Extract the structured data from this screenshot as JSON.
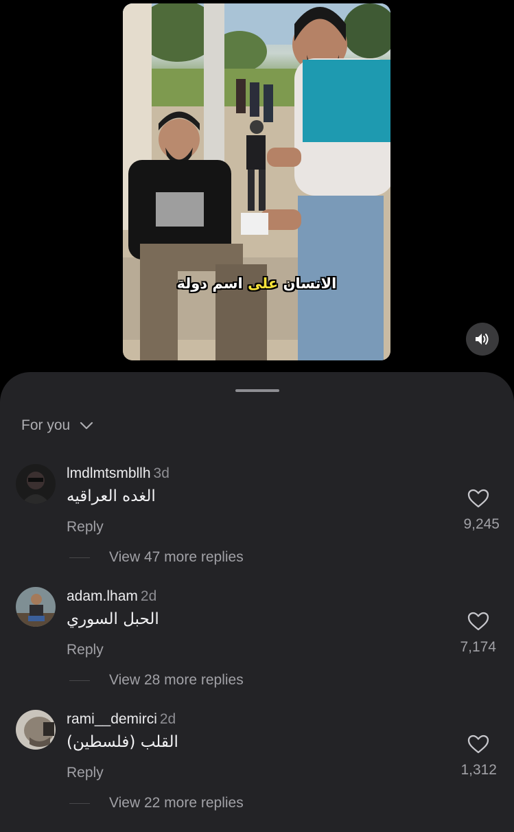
{
  "video": {
    "caption_part1": "الانسان ",
    "caption_highlight": "على",
    "caption_part2": " اسم دولة",
    "sound_icon": "speaker-icon"
  },
  "comments_sheet": {
    "filter_label": "For you",
    "filter_icon": "chevron-down-icon",
    "comments": [
      {
        "username": "lmdlmtsmbllh",
        "time": "3d",
        "text": "الغده العراقيه",
        "reply_label": "Reply",
        "like_count": "9,245",
        "view_replies": "View 47 more replies"
      },
      {
        "username": "adam.lham",
        "time": "2d",
        "text": "الحبل السوري",
        "reply_label": "Reply",
        "like_count": "7,174",
        "view_replies": "View 28 more replies"
      },
      {
        "username": "rami__demirci",
        "time": "2d",
        "text": "القلب (فلسطين)",
        "reply_label": "Reply",
        "like_count": "1,312",
        "view_replies": "View 22 more replies"
      }
    ]
  },
  "colors": {
    "sheet_background": "#232326",
    "caption_highlight": "#f5e23a",
    "secondary_text": "#a1a1a6"
  }
}
